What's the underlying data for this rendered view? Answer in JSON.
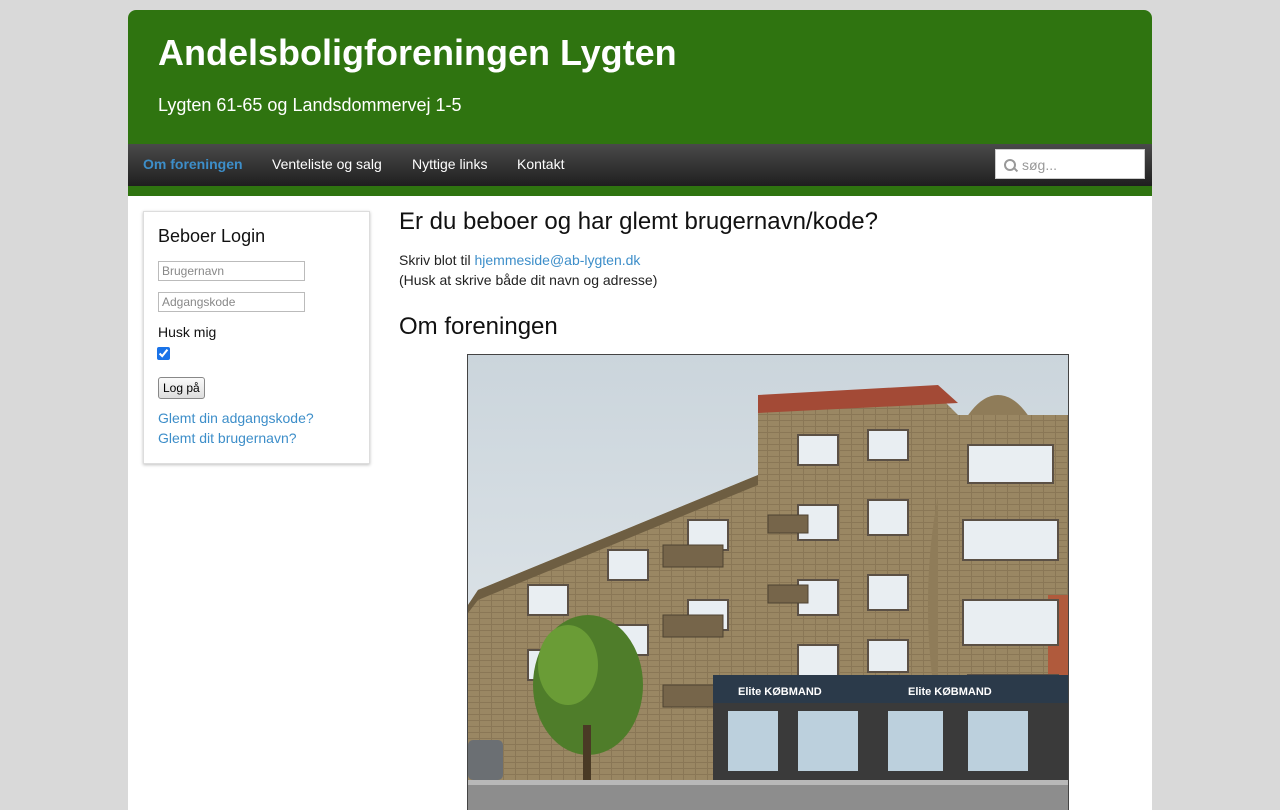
{
  "header": {
    "title": "Andelsboligforeningen Lygten",
    "subtitle": "Lygten 61-65 og Landsdommervej 1-5"
  },
  "nav": {
    "items": [
      {
        "label": "Om foreningen",
        "active": true
      },
      {
        "label": "Venteliste og salg",
        "active": false
      },
      {
        "label": "Nyttige links",
        "active": false
      },
      {
        "label": "Kontakt",
        "active": false
      }
    ],
    "search_placeholder": "søg..."
  },
  "login": {
    "title": "Beboer Login",
    "username_placeholder": "Brugernavn",
    "password_placeholder": "Adgangskode",
    "remember_label": "Husk mig",
    "remember_checked": true,
    "submit_label": "Log på",
    "forgot_password": "Glemt din adgangskode?",
    "forgot_username": "Glemt dit brugernavn?"
  },
  "main": {
    "heading": "Er du beboer og har glemt brugernavn/kode?",
    "line1_prefix": "Skriv blot til",
    "email": "hjemmeside@ab-lygten.dk",
    "line2": "(Husk at skrive både dit navn og adresse)",
    "section_heading": "Om foreningen"
  },
  "photo": {
    "sign_1": "Elite KØBMAND",
    "sign_2": "Elite KØBMAND"
  },
  "colors": {
    "brand_green": "#2f7410",
    "link_blue": "#3d8ec9",
    "nav_dark": "#2a2a2a"
  }
}
